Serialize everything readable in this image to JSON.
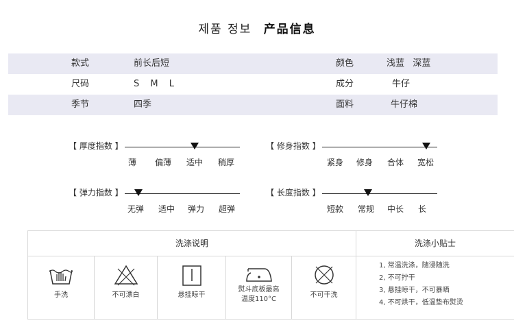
{
  "title": {
    "korean": "제품 정보",
    "chinese": "产品信息"
  },
  "specs": [
    {
      "label1": "款式",
      "value1": "前长后短",
      "label2": "颜色",
      "value2": "浅蓝   深蓝"
    },
    {
      "label1": "尺码",
      "value1": "S M L",
      "label2": "成分",
      "value2": "牛仔"
    },
    {
      "label1": "季节",
      "value1": "四季",
      "label2": "面料",
      "value2": "牛仔棉"
    }
  ],
  "scales": [
    {
      "label": "【 厚度指数 】",
      "options": [
        "薄",
        "偏薄",
        "适中",
        "稍厚"
      ],
      "selected_index": 2
    },
    {
      "label": "【 修身指数 】",
      "options": [
        "紧身",
        "修身",
        "合体",
        "宽松"
      ],
      "selected_index": 3
    },
    {
      "label": "【 弹力指数 】",
      "options": [
        "无弹",
        "适中",
        "弹力",
        "超弹"
      ],
      "selected_index": 0
    },
    {
      "label": "【 长度指数 】",
      "options": [
        "短款",
        "常规",
        "中长",
        "长"
      ],
      "selected_index": 1
    }
  ],
  "care": {
    "wash_header": "洗涤说明",
    "tips_header": "洗涤小贴士",
    "icons": [
      {
        "icon": "hand-wash-icon",
        "caption": "手洗"
      },
      {
        "icon": "no-bleach-icon",
        "caption": "不可漂白"
      },
      {
        "icon": "hang-dry-icon",
        "caption": "悬挂晾干"
      },
      {
        "icon": "iron-icon",
        "caption_line1": "熨斗底板最高",
        "caption_line2": "温度110°C"
      },
      {
        "icon": "no-dry-clean-icon",
        "caption": "不可干洗"
      }
    ],
    "tips": [
      "1, 常温洗涤，随浸随洗",
      "2, 不可拧干",
      "3, 悬挂晾干，不可暴晒",
      "4, 不可烘干，低温垫布熨烫"
    ]
  }
}
